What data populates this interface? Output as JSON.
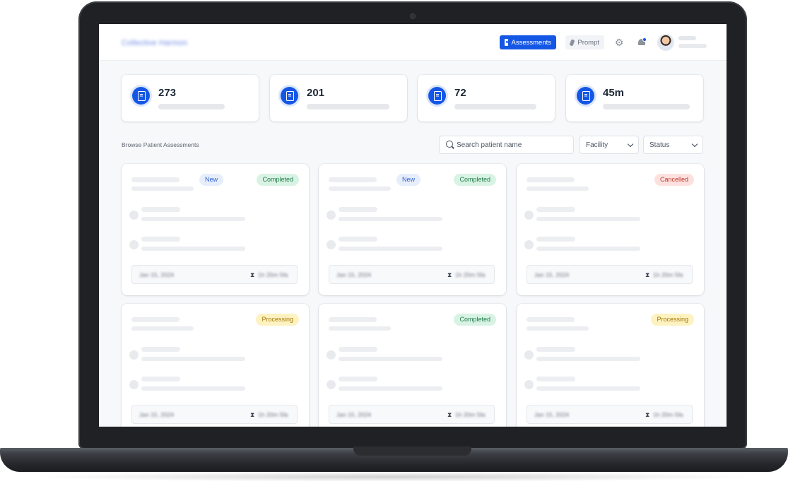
{
  "app": {
    "brand": "Collective Harmon",
    "nav": {
      "assessments_label": "Assessments",
      "prompt_label": "Prompt"
    },
    "icons": {
      "settings": "gear-icon",
      "notifications": "bell-icon",
      "assessments": "document-icon",
      "prompt": "leaf-icon"
    }
  },
  "stats": [
    {
      "value": "273",
      "icon": "document-icon"
    },
    {
      "value": "201",
      "icon": "document-check-icon"
    },
    {
      "value": "72",
      "icon": "document-x-icon"
    },
    {
      "value": "45m",
      "icon": "document-clock-icon"
    }
  ],
  "browse": {
    "title": "Browse Patient Assessments",
    "search_placeholder": "Search patient name",
    "facility_label": "Facility",
    "status_label": "Status"
  },
  "cards": [
    {
      "new_badge": "New",
      "status": "Completed",
      "date": "Jan 15, 2024",
      "duration": "1h 20m 5fa"
    },
    {
      "new_badge": "New",
      "status": "Completed",
      "date": "Jan 15, 2024",
      "duration": "1h 20m 5fa"
    },
    {
      "new_badge": "",
      "status": "Cancelled",
      "date": "Jan 15, 2024",
      "duration": "1h 20m 5fa"
    },
    {
      "new_badge": "",
      "status": "Processing",
      "date": "Jan 15, 2024",
      "duration": "1h 20m 5fa"
    },
    {
      "new_badge": "",
      "status": "Completed",
      "date": "Jan 15, 2024",
      "duration": "1h 20m 5fa"
    },
    {
      "new_badge": "",
      "status": "Processing",
      "date": "Jan 15, 2024",
      "duration": "1h 20m 5fa"
    }
  ],
  "colors": {
    "accent": "#1557e5",
    "completed": "#1f7a48",
    "cancelled": "#c0392b",
    "processing": "#a6780a"
  }
}
